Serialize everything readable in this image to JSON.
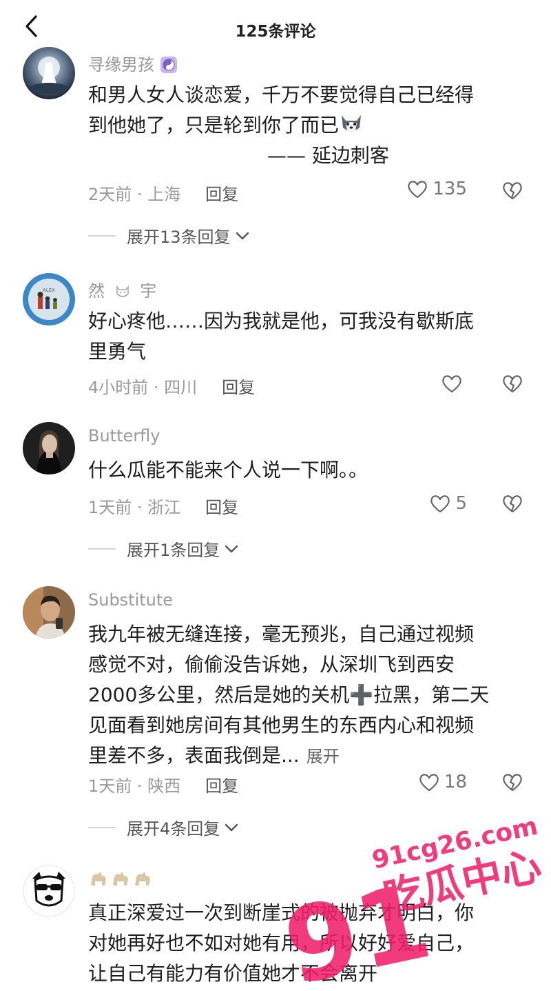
{
  "header": {
    "title": "125条评论"
  },
  "comments": [
    {
      "username": "寻缘男孩",
      "lines": [
        "和男人女人谈恋爱，千万不要觉得自己已经得",
        "到他她了，只是轮到你了而已",
        "—— 延边刺客"
      ],
      "time": "2天前 · 上海",
      "reply": "回复",
      "likes": "135",
      "expand": "展开13条回复"
    },
    {
      "username": "然",
      "username_suffix": "宇",
      "lines": [
        "好心疼他……因为我就是他，可我没有歇斯底",
        "里勇气"
      ],
      "time": "4小时前 · 四川",
      "reply": "回复",
      "likes": ""
    },
    {
      "username": "Butterfly",
      "lines": [
        "什么瓜能不能来个人说一下啊。。"
      ],
      "time": "1天前 · 浙江",
      "reply": "回复",
      "likes": "5",
      "expand": "展开1条回复"
    },
    {
      "username": "Substitute",
      "lines": [
        "我九年被无缝连接，毫无预兆，自己通过视频",
        "感觉不对，偷偷没告诉她，从深圳飞到西安",
        "2000多公里，然后是她的关机➕拉黑，第二天",
        "见面看到她房间有其他男生的东西内心和视频",
        "里差不多，表面我倒是..."
      ],
      "expand_inline": "展开",
      "time": "1天前 · 陕西",
      "reply": "回复",
      "likes": "18",
      "expand": "展开4条回复"
    },
    {
      "username": "",
      "lines": [
        "真正深爱过一次到断崖式的被抛弃才明白，你",
        "对她再好也不如对她有用，所以好好爱自己，",
        "让自己有能力有价值她才不会离开"
      ]
    }
  ],
  "watermark": {
    "number": "91",
    "url": "91cg26.com",
    "text": "吃瓜中心"
  }
}
